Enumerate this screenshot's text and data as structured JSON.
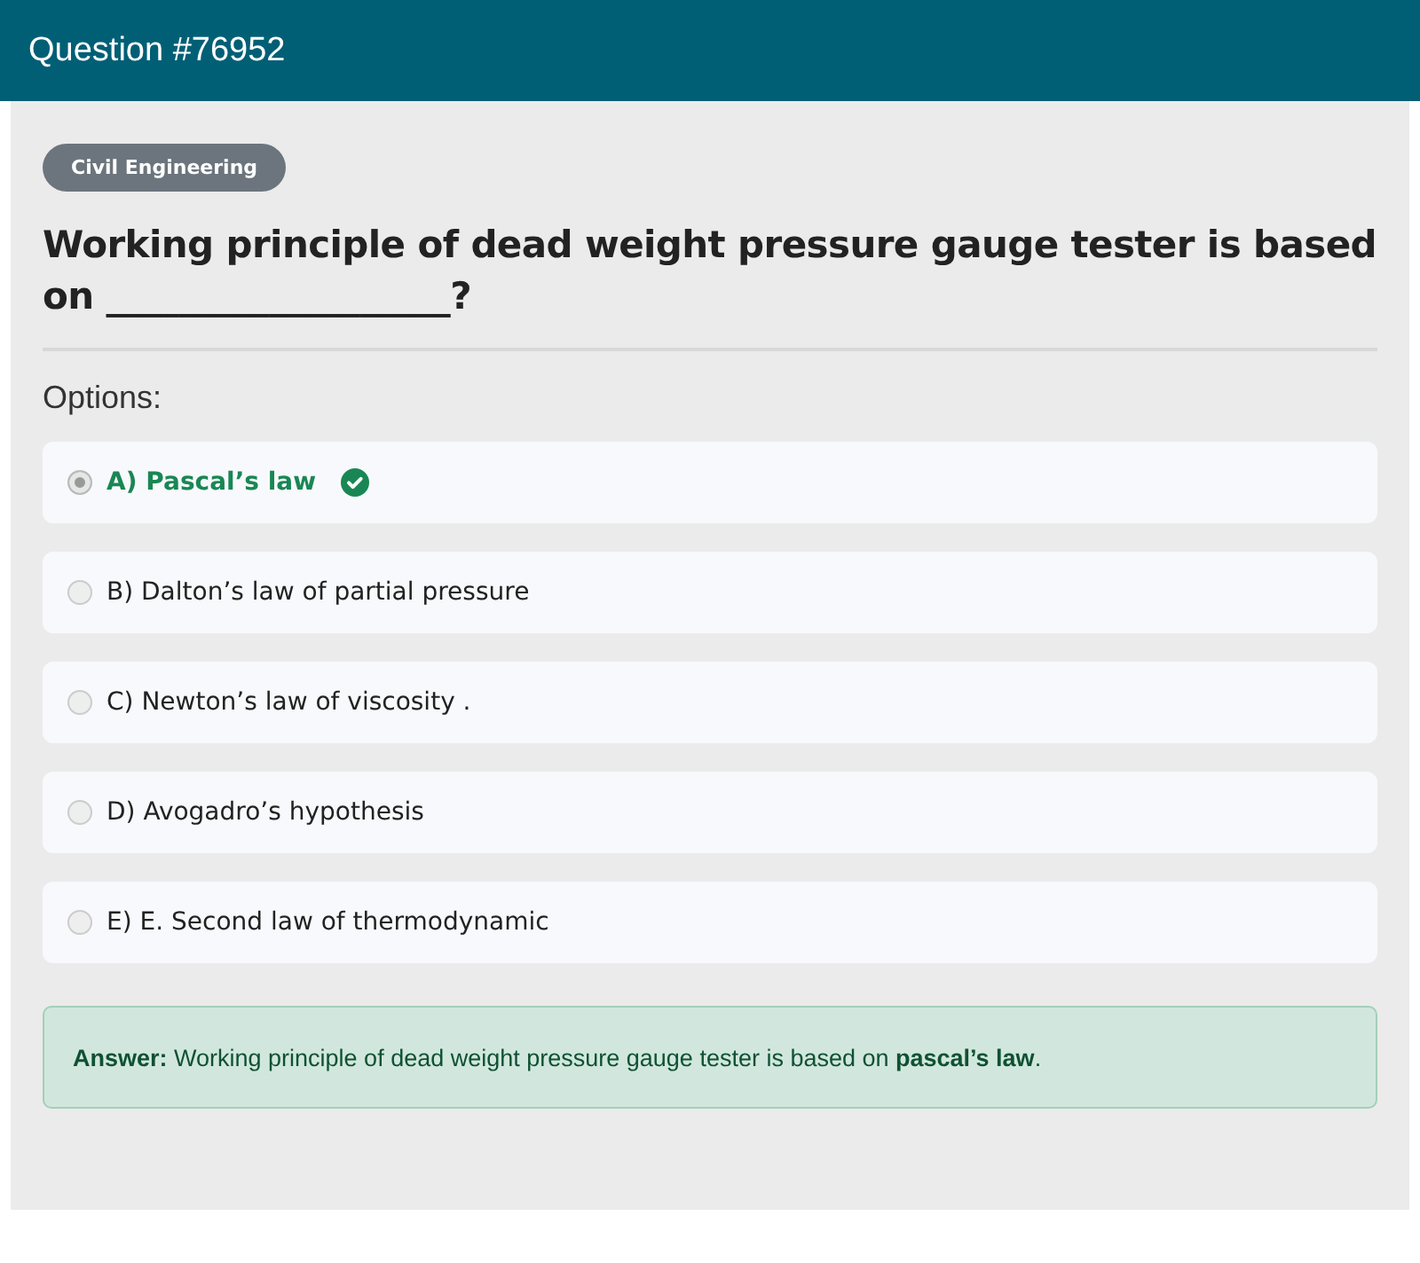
{
  "header": {
    "title": "Question #76952"
  },
  "category": "Civil Engineering",
  "question": "Working principle of dead weight pressure gauge tester is based on ___________________?",
  "options_label": "Options:",
  "options": [
    {
      "text": "A) Pascal’s law",
      "selected": true,
      "correct": true
    },
    {
      "text": "B) Dalton’s law of partial pressure",
      "selected": false,
      "correct": false
    },
    {
      "text": "C) Newton’s law of viscosity .",
      "selected": false,
      "correct": false
    },
    {
      "text": "D) Avogadro’s hypothesis",
      "selected": false,
      "correct": false
    },
    {
      "text": "E) E. Second law of thermodynamic",
      "selected": false,
      "correct": false
    }
  ],
  "answer": "**Answer:** Working principle of dead weight pressure gauge tester is based on **pascal’s law**."
}
